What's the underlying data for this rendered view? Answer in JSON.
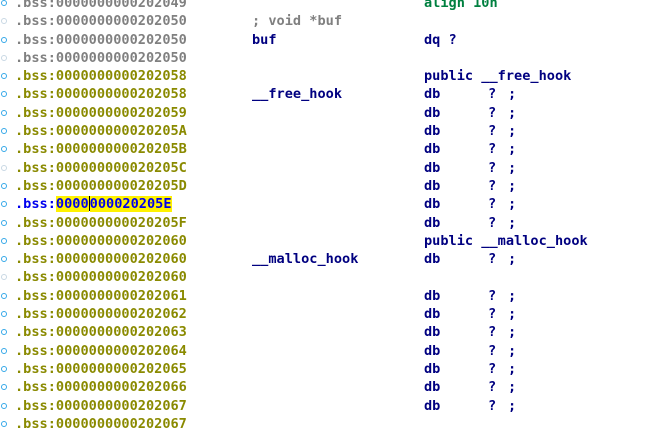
{
  "rows": [
    {
      "addr_prefix": ".bss:",
      "addr": "0000000000202049",
      "label": "",
      "comment": "",
      "instr": "align 10h",
      "operand": "",
      "trail": "",
      "addr_style": "gray",
      "instr_style": "green",
      "marker": "on"
    },
    {
      "addr_prefix": ".bss:",
      "addr": "0000000000202050",
      "label": "",
      "comment": "; void *buf",
      "instr": "",
      "operand": "",
      "trail": "",
      "addr_style": "gray",
      "instr_style": "",
      "marker": "dim"
    },
    {
      "addr_prefix": ".bss:",
      "addr": "0000000000202050",
      "label": "buf",
      "comment": "",
      "instr": "dq ?",
      "operand": "",
      "trail": "",
      "addr_style": "gray",
      "instr_style": "",
      "marker": "on"
    },
    {
      "addr_prefix": ".bss:",
      "addr": "0000000000202050",
      "label": "",
      "comment": "",
      "instr": "",
      "operand": "",
      "trail": "",
      "addr_style": "gray",
      "instr_style": "",
      "marker": "dim"
    },
    {
      "addr_prefix": ".bss:",
      "addr": "0000000000202058",
      "label": "",
      "comment": "",
      "instr": "public __free_hook",
      "operand": "",
      "trail": "",
      "addr_style": "olive",
      "instr_style": "",
      "marker": "on"
    },
    {
      "addr_prefix": ".bss:",
      "addr": "0000000000202058",
      "label": "__free_hook",
      "comment": "",
      "instr": "db",
      "operand": "?",
      "trail": ";",
      "addr_style": "olive",
      "instr_style": "",
      "marker": "on"
    },
    {
      "addr_prefix": ".bss:",
      "addr": "0000000000202059",
      "label": "",
      "comment": "",
      "instr": "db",
      "operand": "?",
      "trail": ";",
      "addr_style": "olive",
      "instr_style": "",
      "marker": "on"
    },
    {
      "addr_prefix": ".bss:",
      "addr": "000000000020205A",
      "label": "",
      "comment": "",
      "instr": "db",
      "operand": "?",
      "trail": ";",
      "addr_style": "olive",
      "instr_style": "",
      "marker": "on"
    },
    {
      "addr_prefix": ".bss:",
      "addr": "000000000020205B",
      "label": "",
      "comment": "",
      "instr": "db",
      "operand": "?",
      "trail": ";",
      "addr_style": "olive",
      "instr_style": "",
      "marker": "on"
    },
    {
      "addr_prefix": ".bss:",
      "addr": "000000000020205C",
      "label": "",
      "comment": "",
      "instr": "db",
      "operand": "?",
      "trail": ";",
      "addr_style": "olive",
      "instr_style": "",
      "marker": "dim"
    },
    {
      "addr_prefix": ".bss:",
      "addr": "000000000020205D",
      "label": "",
      "comment": "",
      "instr": "db",
      "operand": "?",
      "trail": ";",
      "addr_style": "olive",
      "instr_style": "",
      "marker": "on"
    },
    {
      "addr_prefix": ".bss:",
      "addr": "000000000020205E",
      "label": "",
      "comment": "",
      "instr": "db",
      "operand": "?",
      "trail": ";",
      "addr_style": "sel",
      "instr_style": "",
      "marker": "on"
    },
    {
      "addr_prefix": ".bss:",
      "addr": "000000000020205F",
      "label": "",
      "comment": "",
      "instr": "db",
      "operand": "?",
      "trail": ";",
      "addr_style": "olive",
      "instr_style": "",
      "marker": "on"
    },
    {
      "addr_prefix": ".bss:",
      "addr": "0000000000202060",
      "label": "",
      "comment": "",
      "instr": "public __malloc_hook",
      "operand": "",
      "trail": "",
      "addr_style": "olive",
      "instr_style": "",
      "marker": "on"
    },
    {
      "addr_prefix": ".bss:",
      "addr": "0000000000202060",
      "label": "__malloc_hook",
      "comment": "",
      "instr": "db",
      "operand": "?",
      "trail": ";",
      "addr_style": "olive",
      "instr_style": "",
      "marker": "on"
    },
    {
      "addr_prefix": ".bss:",
      "addr": "0000000000202060",
      "label": "",
      "comment": "",
      "instr": "",
      "operand": "",
      "trail": "",
      "addr_style": "olive",
      "instr_style": "",
      "marker": "dim"
    },
    {
      "addr_prefix": ".bss:",
      "addr": "0000000000202061",
      "label": "",
      "comment": "",
      "instr": "db",
      "operand": "?",
      "trail": ";",
      "addr_style": "olive",
      "instr_style": "",
      "marker": "on"
    },
    {
      "addr_prefix": ".bss:",
      "addr": "0000000000202062",
      "label": "",
      "comment": "",
      "instr": "db",
      "operand": "?",
      "trail": ";",
      "addr_style": "olive",
      "instr_style": "",
      "marker": "on"
    },
    {
      "addr_prefix": ".bss:",
      "addr": "0000000000202063",
      "label": "",
      "comment": "",
      "instr": "db",
      "operand": "?",
      "trail": ";",
      "addr_style": "olive",
      "instr_style": "",
      "marker": "on"
    },
    {
      "addr_prefix": ".bss:",
      "addr": "0000000000202064",
      "label": "",
      "comment": "",
      "instr": "db",
      "operand": "?",
      "trail": ";",
      "addr_style": "olive",
      "instr_style": "",
      "marker": "on"
    },
    {
      "addr_prefix": ".bss:",
      "addr": "0000000000202065",
      "label": "",
      "comment": "",
      "instr": "db",
      "operand": "?",
      "trail": ";",
      "addr_style": "olive",
      "instr_style": "",
      "marker": "on"
    },
    {
      "addr_prefix": ".bss:",
      "addr": "0000000000202066",
      "label": "",
      "comment": "",
      "instr": "db",
      "operand": "?",
      "trail": ";",
      "addr_style": "olive",
      "instr_style": "",
      "marker": "on"
    },
    {
      "addr_prefix": ".bss:",
      "addr": "0000000000202067",
      "label": "",
      "comment": "",
      "instr": "db",
      "operand": "?",
      "trail": ";",
      "addr_style": "olive",
      "instr_style": "",
      "marker": "on"
    },
    {
      "addr_prefix": ".bss:",
      "addr": "0000000000202067",
      "label": "",
      "comment": "",
      "instr": "",
      "operand": "",
      "trail": "",
      "addr_style": "olive",
      "instr_style": "",
      "marker": "on"
    }
  ],
  "selection": {
    "row": 11,
    "highlighted_text": "0000",
    "rest_text": "000020205E"
  },
  "colors": {
    "address_olive": "#8a8a00",
    "address_gray": "#808080",
    "address_selected": "#0000ee",
    "label_navy": "#000080",
    "directive_green": "#008040",
    "highlight_yellow": "#fff200",
    "marker_blue": "#35a8e8"
  }
}
